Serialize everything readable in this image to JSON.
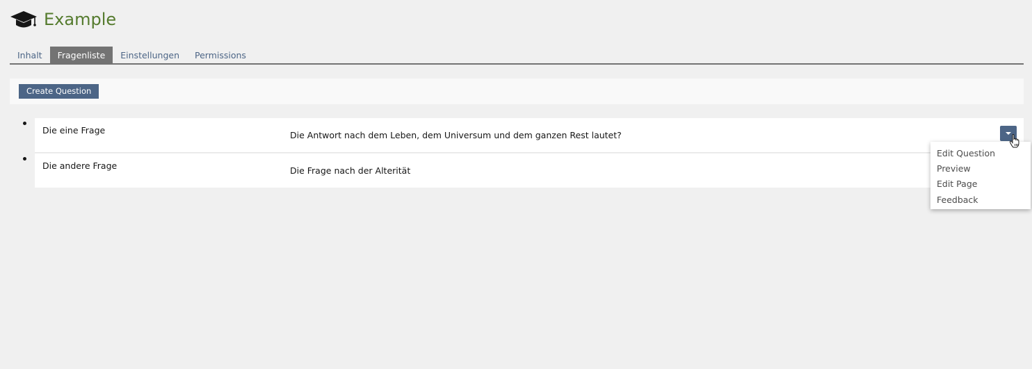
{
  "header": {
    "title": "Example",
    "icon": "graduation-cap-icon",
    "title_color": "#557b2e"
  },
  "tabs": [
    {
      "label": "Inhalt",
      "active": false
    },
    {
      "label": "Fragenliste",
      "active": true
    },
    {
      "label": "Einstellungen",
      "active": false
    },
    {
      "label": "Permissions",
      "active": false
    }
  ],
  "toolbar": {
    "create_label": "Create Question"
  },
  "questions": [
    {
      "title": "Die eine Frage",
      "text": "Die Antwort nach dem Leben, dem Universum und dem ganzen Rest lautet?"
    },
    {
      "title": "Die andere Frage",
      "text": "Die Frage nach der Alterität"
    }
  ],
  "actions_menu": {
    "items": [
      "Edit Question",
      "Preview",
      "Edit Page",
      "Feedback"
    ]
  },
  "colors": {
    "accent": "#4c6586",
    "tab_active": "#737373",
    "background": "#f0f0f0"
  }
}
